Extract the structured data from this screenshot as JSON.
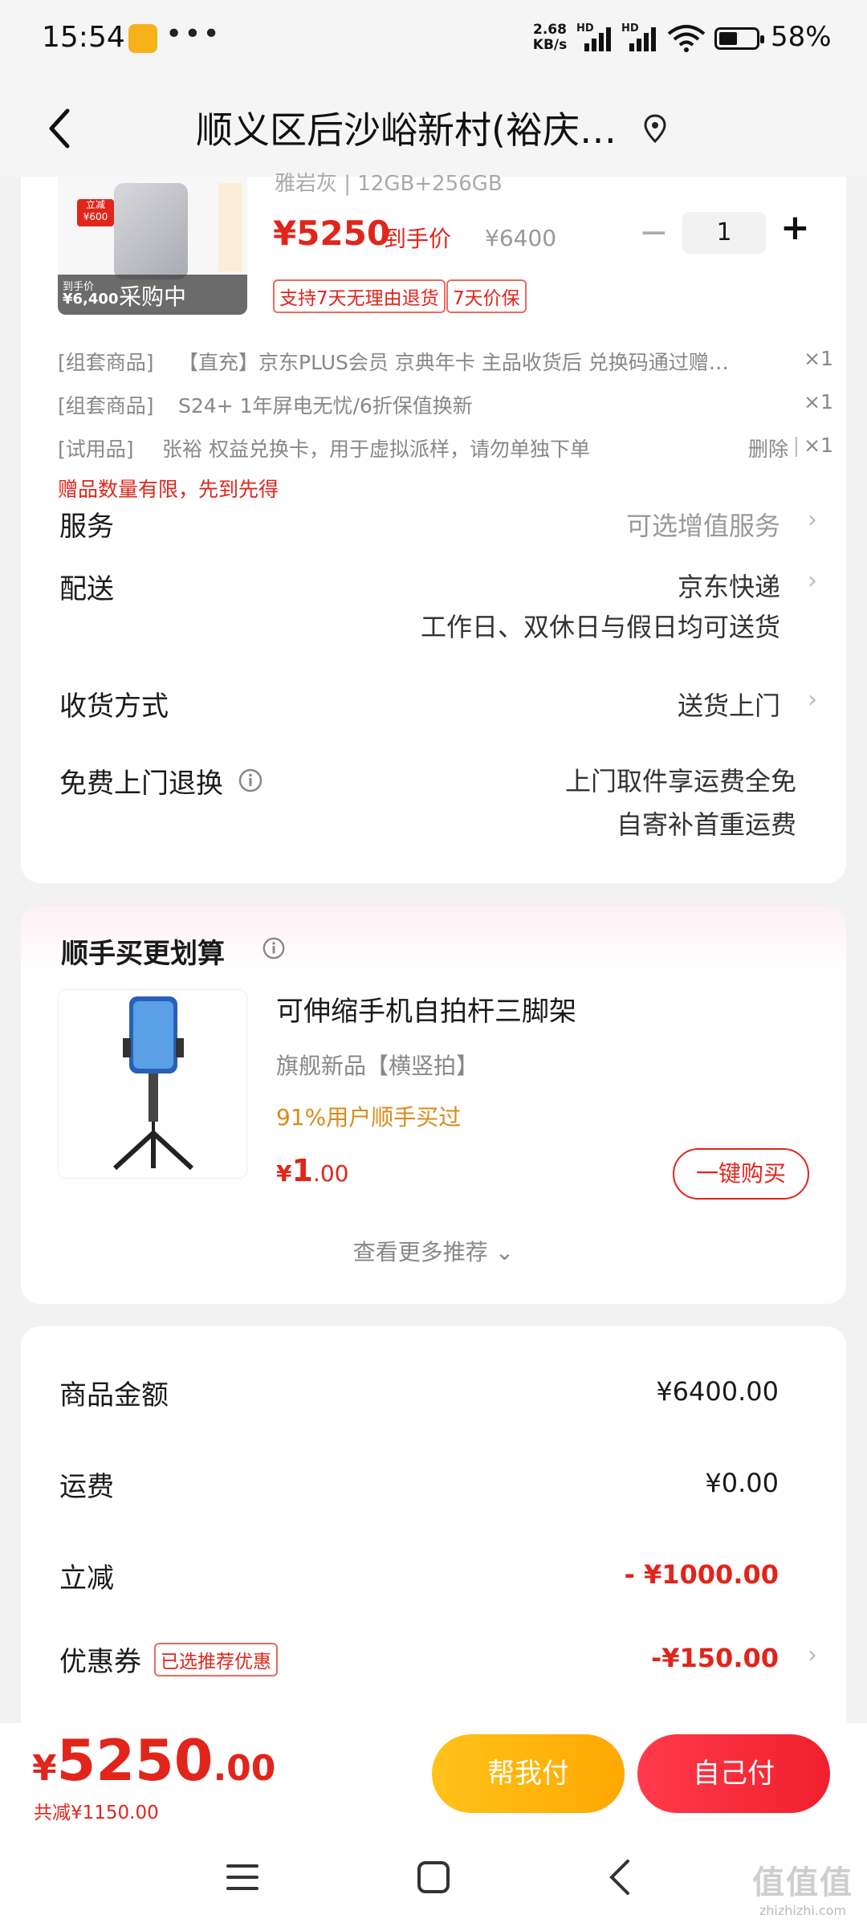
{
  "status_bar": {
    "time": "15:54",
    "dots": "•••",
    "speed_value": "2.68",
    "speed_unit": "KB/s",
    "hd1": "HD",
    "hd2": "HD",
    "battery": "58%"
  },
  "header": {
    "title": "顺义区后沙峪新村(裕庆…",
    "back_icon": "chevron-left-icon",
    "location_icon": "location-pin-icon"
  },
  "product": {
    "spec": "雅岩灰 | 12GB+256GB",
    "price": "¥5250",
    "price_suffix": "到手价",
    "original_price": "¥6400",
    "quantity": "1",
    "minus": "−",
    "plus": "+",
    "image_overlay": "采购中",
    "image_badge": "立减 ¥600",
    "image_small_price": "¥6,400",
    "image_small_label": "到手价",
    "tags": [
      "支持7天无理由退货",
      "7天价保"
    ]
  },
  "bundle_items": [
    {
      "type": "[组套商品]",
      "name": "【直充】京东PLUS会员 京典年卡  主品收货后 兑换码通过赠…",
      "qty": "×1",
      "action": ""
    },
    {
      "type": "[组套商品]",
      "name": "S24+ 1年屏电无忧/6折保值换新",
      "qty": "×1",
      "action": ""
    },
    {
      "type": "[试用品]",
      "name": "张裕 权益兑换卡，用于虚拟派样，请勿单独下单",
      "qty": "×1",
      "action": "删除"
    }
  ],
  "gift_notice": "赠品数量有限，先到先得",
  "service": {
    "label": "服务",
    "value": "可选增值服务"
  },
  "delivery": {
    "label": "配送",
    "value": "京东快递",
    "note": "工作日、双休日与假日均可送货"
  },
  "receive": {
    "label": "收货方式",
    "value": "送货上门"
  },
  "return": {
    "label": "免费上门退换",
    "line1": "上门取件享运费全免",
    "line2": "自寄补首重运费"
  },
  "recommend": {
    "title": "顺手买更划算",
    "item_name": "可伸缩手机自拍杆三脚架",
    "item_sub": "旗舰新品【横竖拍】",
    "item_stat": "91%用户顺手买过",
    "price_symbol": "¥",
    "price_int": "1",
    "price_dec": ".00",
    "buy_button": "一键购买",
    "more": "查看更多推荐"
  },
  "summary": {
    "goods_label": "商品金额",
    "goods_value": "¥6400.00",
    "shipping_label": "运费",
    "shipping_value": "¥0.00",
    "discount_label": "立减",
    "discount_value": "- ¥1000.00",
    "coupon_label": "优惠券",
    "coupon_tag": "已选推荐优惠",
    "coupon_value": "-¥150.00"
  },
  "footer": {
    "total_symbol": "¥",
    "total_int": "5250",
    "total_dec": ".00",
    "saved": "共减¥1150.00",
    "help_pay": "帮我付",
    "self_pay": "自己付"
  },
  "watermark": {
    "line1": "值值值",
    "line2": "zhizhizhi.com"
  },
  "colors": {
    "accent_red": "#e1251b",
    "pay_red": "#f2263c",
    "help_yellow": "#ffb400"
  }
}
